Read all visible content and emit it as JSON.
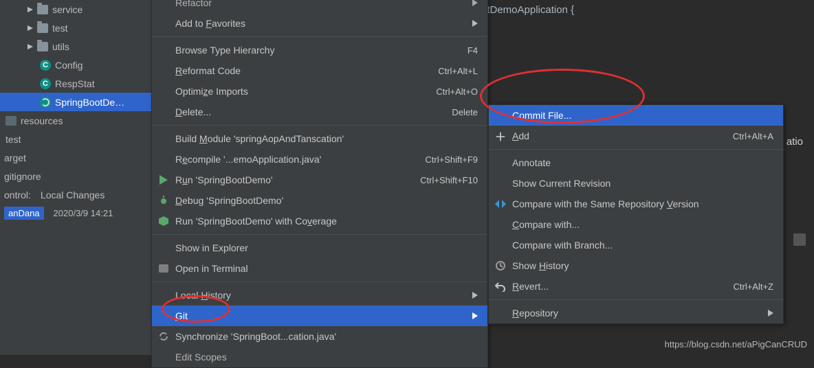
{
  "tree": {
    "items": [
      {
        "label": "service"
      },
      {
        "label": "test"
      },
      {
        "label": "utils"
      },
      {
        "label": "Config"
      },
      {
        "label": "RespStat"
      },
      {
        "label": "SpringBootDe…"
      }
    ],
    "groups": [
      {
        "label": "resources"
      },
      {
        "label": "test"
      }
    ],
    "stray": [
      {
        "label": "arget"
      },
      {
        "label": "gitignore"
      }
    ],
    "vc": {
      "label_left": "ontrol:",
      "label_right": "Local Changes"
    },
    "commit": {
      "who": "anDana",
      "when": "2020/3/9 14:21"
    }
  },
  "editor": {
    "line1_suffix": "otDemoApplication {",
    "ann": "atio"
  },
  "menu1": {
    "items": [
      {
        "label": "Refactor",
        "arrow": true,
        "cut": true
      },
      {
        "label": "Add to Favorites",
        "u": "F",
        "arrow": true
      },
      {
        "sep": true
      },
      {
        "label": "Browse Type Hierarchy",
        "sc": "F4"
      },
      {
        "label": "Reformat Code",
        "u": "R",
        "sc": "Ctrl+Alt+L"
      },
      {
        "label": "Optimize Imports",
        "u": "z",
        "sc": "Ctrl+Alt+O"
      },
      {
        "label": "Delete...",
        "u": "D",
        "sc": "Delete"
      },
      {
        "sep": true
      },
      {
        "label": "Build Module 'springAopAndTanscation'",
        "u": "M"
      },
      {
        "label": "Recompile '...emoApplication.java'",
        "u": "e",
        "sc": "Ctrl+Shift+F9"
      },
      {
        "label": "Run 'SpringBootDemo'",
        "u": "u",
        "sc": "Ctrl+Shift+F10",
        "icon": "run"
      },
      {
        "label": "Debug 'SpringBootDemo'",
        "u": "D",
        "icon": "bug"
      },
      {
        "label": "Run 'SpringBootDemo' with Coverage",
        "u": "v",
        "icon": "cov"
      },
      {
        "sep": true
      },
      {
        "label": "Show in Explorer"
      },
      {
        "label": "Open in Terminal",
        "icon": "term"
      },
      {
        "sep": true
      },
      {
        "label": "Local History",
        "u": "H",
        "arrow": true
      },
      {
        "label": "Git",
        "u": "G",
        "arrow": true,
        "sel": true
      },
      {
        "label": "Synchronize 'SpringBoot...cation.java'",
        "icon": "sync"
      },
      {
        "label": "Edit Scopes",
        "cut": true
      }
    ]
  },
  "menu2": {
    "items": [
      {
        "label": "Commit File...",
        "u": "m",
        "sel": true
      },
      {
        "label": "Add",
        "u": "A",
        "sc": "Ctrl+Alt+A",
        "icon": "plus"
      },
      {
        "sep": true
      },
      {
        "label": "Annotate"
      },
      {
        "label": "Show Current Revision"
      },
      {
        "label": "Compare with the Same Repository Version",
        "u": "V",
        "icon": "cmp"
      },
      {
        "label": "Compare with...",
        "u": "C"
      },
      {
        "label": "Compare with Branch..."
      },
      {
        "label": "Show History",
        "u": "H",
        "icon": "hist"
      },
      {
        "label": "Revert...",
        "u": "R",
        "sc": "Ctrl+Alt+Z",
        "icon": "rev"
      },
      {
        "sep": true
      },
      {
        "label": "Repository",
        "u": "R",
        "arrow": true
      }
    ]
  },
  "watermark": "https://blog.csdn.net/aPigCanCRUD"
}
